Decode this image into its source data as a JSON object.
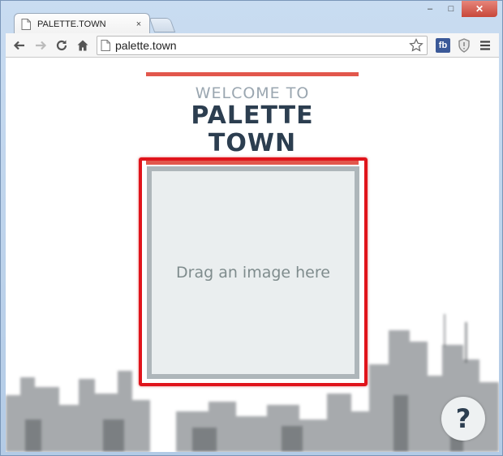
{
  "browser": {
    "tab": {
      "title": "PALETTE.TOWN",
      "close_label": "×"
    },
    "window_controls": {
      "minimize": "‒",
      "maximize": "□",
      "close": "✕"
    },
    "address_bar": {
      "url": "palette.town"
    },
    "extensions": {
      "fb_label": "fb"
    }
  },
  "page": {
    "welcome": "WELCOME TO",
    "title": "PALETTE TOWN",
    "dropzone_text": "Drag an image here",
    "help_label": "?"
  },
  "colors": {
    "accent_red": "#e2574c",
    "title_dark": "#2c3e50",
    "highlight_red": "#e0141b",
    "dropzone_bg": "#eaeeef"
  }
}
